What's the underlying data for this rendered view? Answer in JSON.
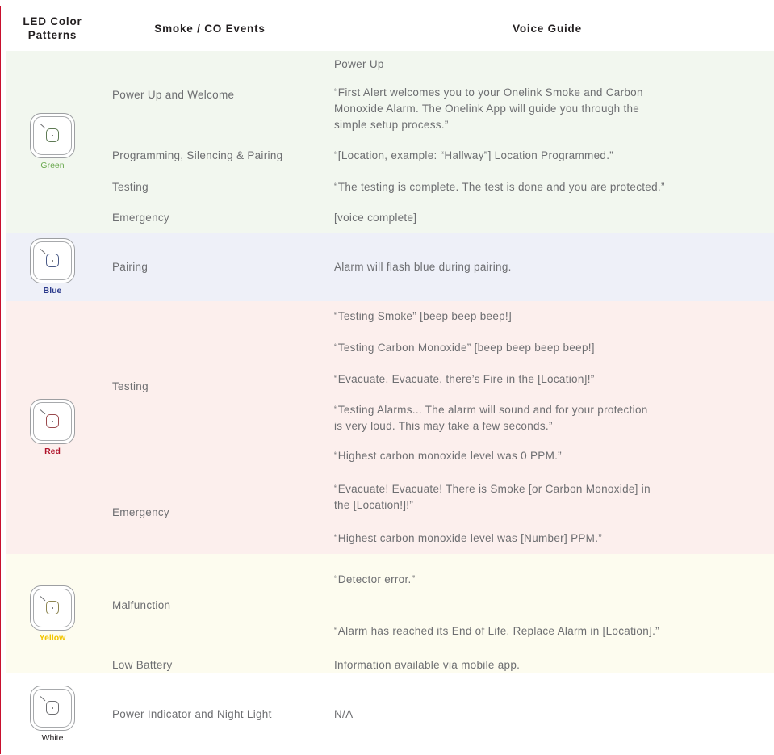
{
  "colors": {
    "rule": "#c8102e",
    "text": "#6d6e71",
    "header_text": "#231f20",
    "green_bg": "#f2f7ef",
    "blue_bg": "#eef0f8",
    "red_bg": "#fcefed",
    "yellow_bg": "#fdfcef",
    "white_bg": "#ffffff"
  },
  "header": {
    "led": "LED Color Patterns",
    "events": "Smoke / CO Events",
    "voice": "Voice Guide"
  },
  "groups": [
    {
      "key": "green",
      "label": "Green",
      "label_color": "#6aa84f",
      "label_bold": false,
      "button_color": "#5e7a54",
      "icon": "smoke-alarm-icon",
      "events": [
        {
          "name": "Power Up and Welcome",
          "voices": [
            "Power Up",
            "“First Alert welcomes you to your Onelink Smoke and Carbon Monoxide Alarm. The Onelink App will guide you through the simple setup process.”"
          ]
        },
        {
          "name": "Programming, Silencing & Pairing",
          "voices": [
            "“[Location, example: “Hallway”] Location Programmed.”"
          ]
        },
        {
          "name": "Testing",
          "voices": [
            "“The testing is complete. The test is done and you are protected.”"
          ]
        },
        {
          "name": "Emergency",
          "voices": [
            "[voice complete]"
          ]
        }
      ]
    },
    {
      "key": "blue",
      "label": "Blue",
      "label_color": "#2b3a8c",
      "label_bold": true,
      "button_color": "#4a5a86",
      "icon": "smoke-alarm-icon",
      "events": [
        {
          "name": "Pairing",
          "voices": [
            "Alarm will flash blue during pairing."
          ]
        }
      ]
    },
    {
      "key": "red",
      "label": "Red",
      "label_color": "#b0132b",
      "label_bold": true,
      "button_color": "#9a4a4e",
      "icon": "smoke-alarm-icon",
      "events": [
        {
          "name": "Testing",
          "voices": [
            "“Testing Smoke” [beep beep beep!]",
            "“Testing Carbon Monoxide” [beep beep beep beep!]",
            "“Evacuate, Evacuate, there’s Fire in the [Location]!”",
            "“Testing Alarms... The alarm will sound and for your protection is very loud. This may take a few seconds.”",
            "“Highest carbon monoxide level was 0 PPM.”"
          ]
        },
        {
          "name": "Emergency",
          "voices": [
            "“Evacuate! Evacuate! There is Smoke [or Carbon Monoxide] in the [Location!]!”",
            "“Highest carbon monoxide level was [Number] PPM.”"
          ]
        }
      ]
    },
    {
      "key": "yellow",
      "label": "Yellow",
      "label_color": "#f2c500",
      "label_bold": true,
      "button_color": "#8c8450",
      "icon": "smoke-alarm-icon",
      "events": [
        {
          "name": "Malfunction",
          "voices": [
            "“Detector error.”",
            "“Alarm has reached its End of Life. Replace Alarm in [Location].”"
          ]
        },
        {
          "name": "Low Battery",
          "voices": [
            "Information available via mobile app."
          ]
        }
      ]
    },
    {
      "key": "white",
      "label": "White",
      "label_color": "#231f20",
      "label_bold": false,
      "button_color": "#6d6e71",
      "icon": "smoke-alarm-icon",
      "events": [
        {
          "name": "Power Indicator and Night Light",
          "voices": [
            "N/A"
          ]
        }
      ]
    }
  ]
}
